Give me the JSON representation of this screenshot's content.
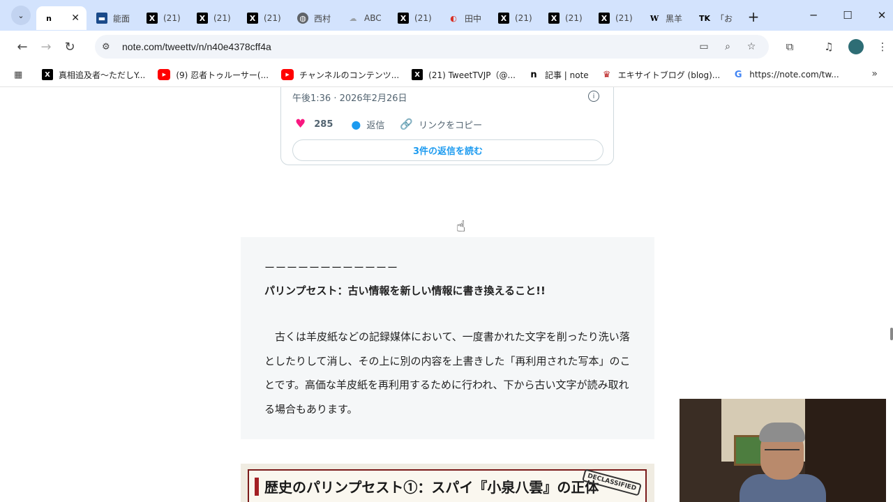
{
  "browser": {
    "tabs": [
      {
        "label": "",
        "icon": "note-n-icon",
        "active": true
      },
      {
        "label": "能面",
        "icon": "news-icon"
      },
      {
        "label": "(21)",
        "icon": "x-icon"
      },
      {
        "label": "(21)",
        "icon": "x-icon"
      },
      {
        "label": "(21)",
        "icon": "x-icon"
      },
      {
        "label": "西村",
        "icon": "globe-icon"
      },
      {
        "label": "ABC",
        "icon": "cloud-icon"
      },
      {
        "label": "(21)",
        "icon": "x-icon"
      },
      {
        "label": "田中",
        "icon": "red-logo-icon"
      },
      {
        "label": "(21)",
        "icon": "x-icon"
      },
      {
        "label": "(21)",
        "icon": "x-icon"
      },
      {
        "label": "(21)",
        "icon": "x-icon"
      },
      {
        "label": "黒羊",
        "icon": "wikipedia-icon"
      },
      {
        "label": "「お",
        "icon": "tk-icon"
      }
    ],
    "url": "note.com/tweettv/n/n40e4378cff4a",
    "bookmarks": [
      {
        "label": "真相追及者〜ただしY...",
        "icon": "x-icon"
      },
      {
        "label": "(9) 忍者トゥルーサー(...",
        "icon": "youtube-icon"
      },
      {
        "label": "チャンネルのコンテンツ...",
        "icon": "youtube-icon"
      },
      {
        "label": "(21) TweetTVJP（@...",
        "icon": "x-icon"
      },
      {
        "label": "記事 | note",
        "icon": "note-n-icon"
      },
      {
        "label": "エキサイトブログ (blog)...",
        "icon": "excite-icon"
      },
      {
        "label": "https://note.com/tw...",
        "icon": "google-icon"
      }
    ]
  },
  "tweet": {
    "date": "午後1:36 · 2026年2月26日",
    "likes": "285",
    "reply_label": "返信",
    "copy_link_label": "リンクをコピー",
    "read_replies_label": "3件の返信を読む"
  },
  "article": {
    "dashes": "ーーーーーーーーーーーー",
    "heading": "パリンプセスト：古い情報を新しい情報に書き換えること!!",
    "body": "　古くは羊皮紙などの記録媒体において、一度書かれた文字を削ったり洗い落としたりして消し、その上に別の内容を上書きした「再利用された写本」のことです。高価な羊皮紙を再利用するために行われ、下から古い文字が読み取れる場合もあります。",
    "chapter_title": "歴史のパリンプセスト①：スパイ『小泉八雲』の正体",
    "stamp": "DECLASSIFIED"
  }
}
